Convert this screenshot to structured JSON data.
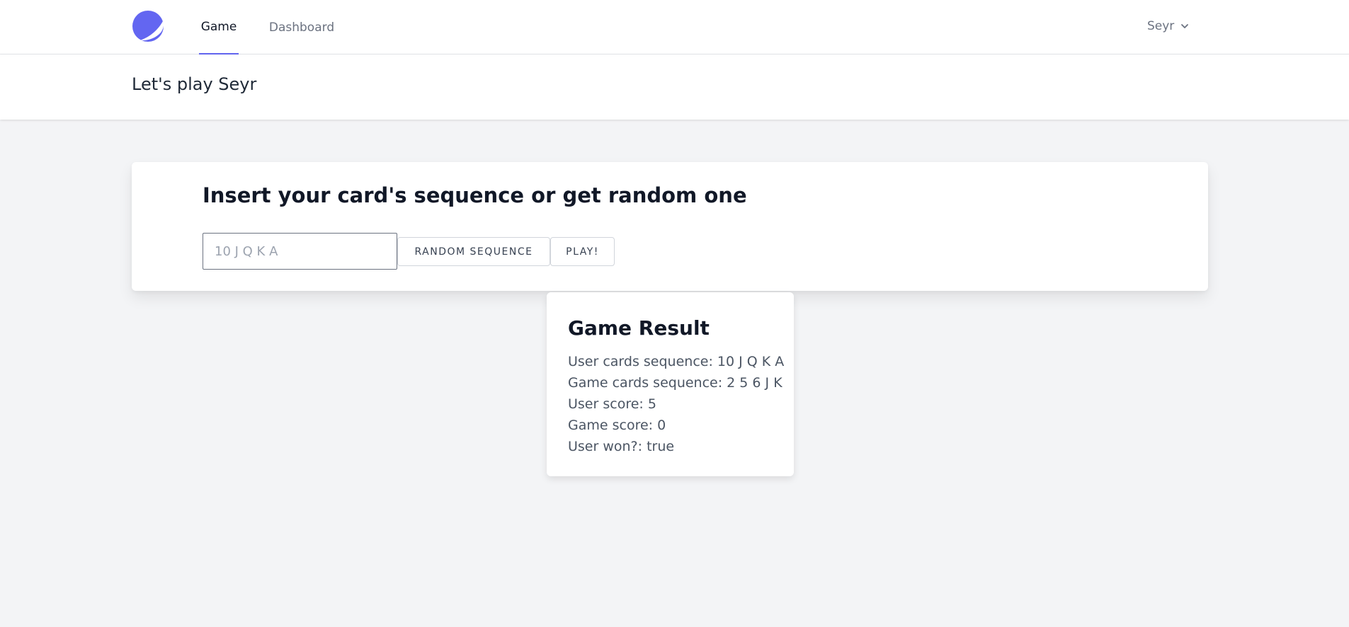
{
  "nav": {
    "logo": "logo-icon",
    "links": [
      {
        "label": "Game",
        "active": true
      },
      {
        "label": "Dashboard",
        "active": false
      }
    ],
    "user": {
      "name": "Seyr",
      "icon": "chevron-down-icon"
    }
  },
  "header": {
    "title": "Let's play Seyr"
  },
  "game_form": {
    "heading": "Insert your card's sequence or get random one",
    "input_placeholder": "10 J Q K A",
    "input_value": "",
    "random_button": "RANDOM SEQUENCE",
    "play_button": "PLAY!"
  },
  "result": {
    "title": "Game Result",
    "lines": [
      "User cards sequence: 10 J Q K A",
      "Game cards sequence: 2 5 6 J K",
      "User score: 5",
      "Game score: 0",
      "User won?: true"
    ]
  },
  "colors": {
    "accent": "#6366f1",
    "page_background": "#f3f4f6",
    "card_background": "#ffffff"
  }
}
